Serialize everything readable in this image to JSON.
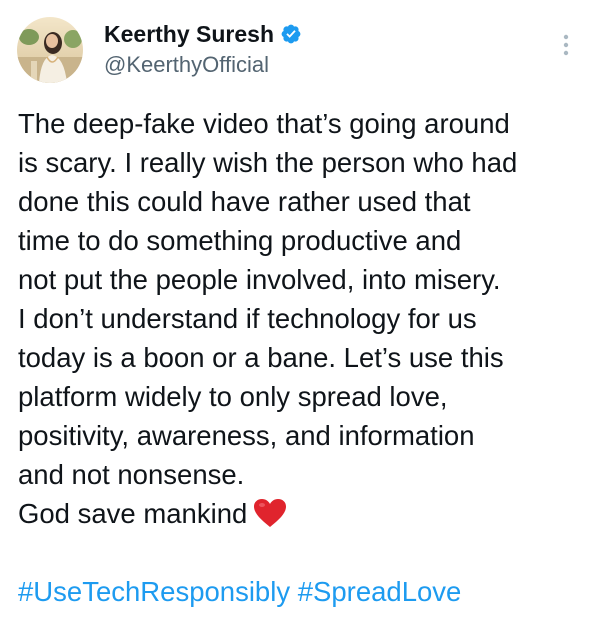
{
  "author": {
    "display_name": "Keerthy Suresh",
    "handle": "@KeerthyOfficial",
    "verified": true,
    "avatar_icon": "profile-photo"
  },
  "more_icon": "vertical-ellipsis-icon",
  "tweet": {
    "lines": [
      "The deep-fake video that’s going around",
      "is scary. I really wish the person who had",
      "done this could have rather used that",
      "time to do something productive and",
      "not put the people involved, into misery.",
      "I don’t understand if technology for us",
      "today is a boon or a bane. Let’s use this",
      "platform widely to only spread love,",
      "positivity, awareness, and information",
      "and not nonsense.",
      "God save mankind"
    ],
    "emoji": "red-heart",
    "hashtags": [
      "#UseTechResponsibly",
      "#SpreadLove"
    ]
  },
  "colors": {
    "text": "#0f1419",
    "secondary_text": "#536471",
    "link": "#1d9bf0",
    "verified_badge": "#1d9bf0",
    "heart": "#e0242d"
  }
}
